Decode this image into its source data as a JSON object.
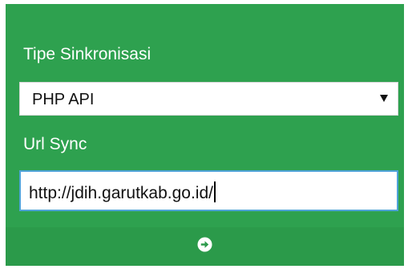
{
  "form": {
    "sync_type_label": "Tipe Sinkronisasi",
    "sync_type_selected": "PHP API",
    "url_sync_label": "Url Sync",
    "url_sync_value": "http://jdih.garutkab.go.id/"
  },
  "footer": {
    "submit_icon": "arrow-circle-right-icon"
  },
  "colors": {
    "panel_background": "#2ea14f",
    "footer_background": "#2b9a4a",
    "input_focus_border": "#4fa3d8"
  }
}
